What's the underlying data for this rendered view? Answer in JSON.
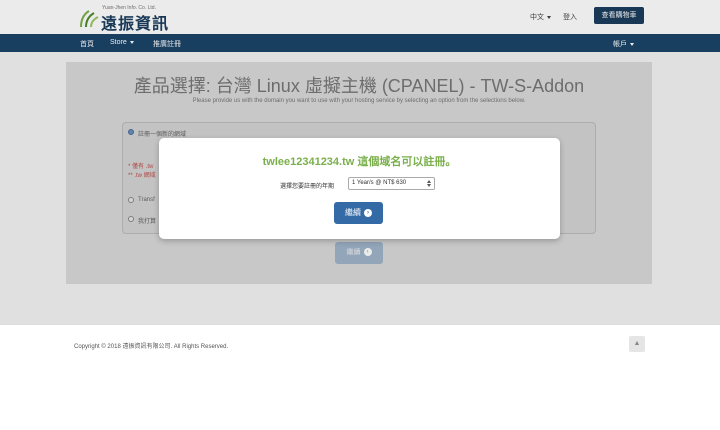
{
  "header": {
    "logo_small": "Yuan-Jhen Info. Co. Ltd.",
    "logo_text": "遠振資訊",
    "language": "中文",
    "login": "登入",
    "cart_button": "查看購物車"
  },
  "nav": {
    "home": "首頁",
    "store": "Store",
    "promo": "推廣註冊",
    "account": "帳戶"
  },
  "main": {
    "title": "產品選擇: 台灣 Linux 虛擬主機 (CPANEL) - TW-S-Addon",
    "subtitle": "Please provide us with the domain you want to use with your hosting service by selecting an option from the selections below.",
    "option_register": "註冊一個新的網域",
    "note1": "* 僅有 .tw",
    "note2": "** .tw 網域",
    "option_transfer": "Transf",
    "option_own": "我打算",
    "continue_bg": "繼續"
  },
  "modal": {
    "title": "twlee12341234.tw 這個域名可以註冊。",
    "period_label": "選擇您要註冊的年期",
    "period_selected": "1 Year/s @ NT$ 630",
    "continue": "繼續"
  },
  "footer": {
    "copyright": "Copyright © 2018 遠振資訊有限公司. All Rights Reserved."
  },
  "colors": {
    "brand": "#1c4569",
    "success": "#7ab04b",
    "button": "#346aa6"
  }
}
